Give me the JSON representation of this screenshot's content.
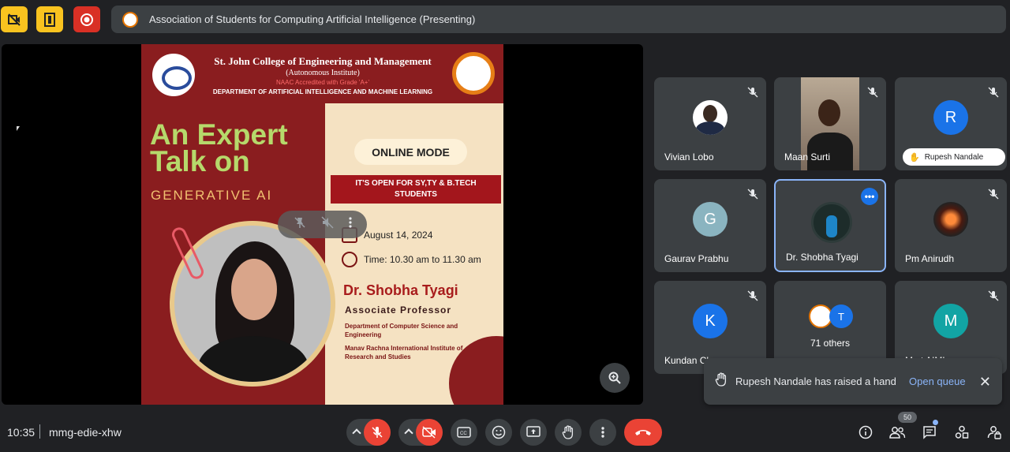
{
  "presenting_title": "Association of Students for Computing Artificial Intelligence (Presenting)",
  "poster": {
    "college": "St. John College of Engineering and Management",
    "autonomous": "(Autonomous Institute)",
    "naac": "NAAC Accredited with Grade 'A+'",
    "department": "DEPARTMENT OF ARTIFICIAL INTELLIGENCE AND MACHINE LEARNING",
    "headline_1": "An Expert",
    "headline_2": "Talk on",
    "topic": "GENERATIVE AI",
    "mode": "ONLINE MODE",
    "open_for_1": "IT'S OPEN FOR SY,TY & B.TECH",
    "open_for_2": "STUDENTS",
    "date": "August 14, 2024",
    "time": "Time:  10.30 am to 11.30 am",
    "speaker": "Dr. Shobha Tyagi",
    "role": "Associate Professor",
    "affiliation_1": "Department of Computer Science and Engineering",
    "affiliation_2": "Manav Rachna International Institute of Research and Studies"
  },
  "participants": [
    {
      "name": "Vivian Lobo",
      "kind": "photo"
    },
    {
      "name": "Maan Surti",
      "kind": "video"
    },
    {
      "name": "",
      "kind": "letter",
      "initial": "R",
      "color": "#1a73e8",
      "raised_by": "Rupesh Nandale"
    },
    {
      "name": "Gaurav Prabhu",
      "kind": "letter",
      "initial": "G",
      "color": "#8ab4c0"
    },
    {
      "name": "Dr. Shobha Tyagi",
      "kind": "ring"
    },
    {
      "name": "Pm Anirudh",
      "kind": "spark"
    },
    {
      "name": "Kundan Ch...",
      "kind": "letter",
      "initial": "K",
      "color": "#1a73e8"
    },
    {
      "name": "71 others",
      "kind": "others",
      "initial": "T"
    },
    {
      "name": "M...t AIML",
      "kind": "letter",
      "initial": "M",
      "color": "#12a4a4"
    }
  ],
  "toast": {
    "message": "Rupesh Nandale has raised a hand",
    "action": "Open queue"
  },
  "bottom": {
    "time": "10:35",
    "meeting_code": "mmg-edie-xhw",
    "people_count": "50"
  },
  "colors": {
    "accent": "#8ab4f8",
    "danger": "#ea4335",
    "warning": "#f9c31f"
  }
}
